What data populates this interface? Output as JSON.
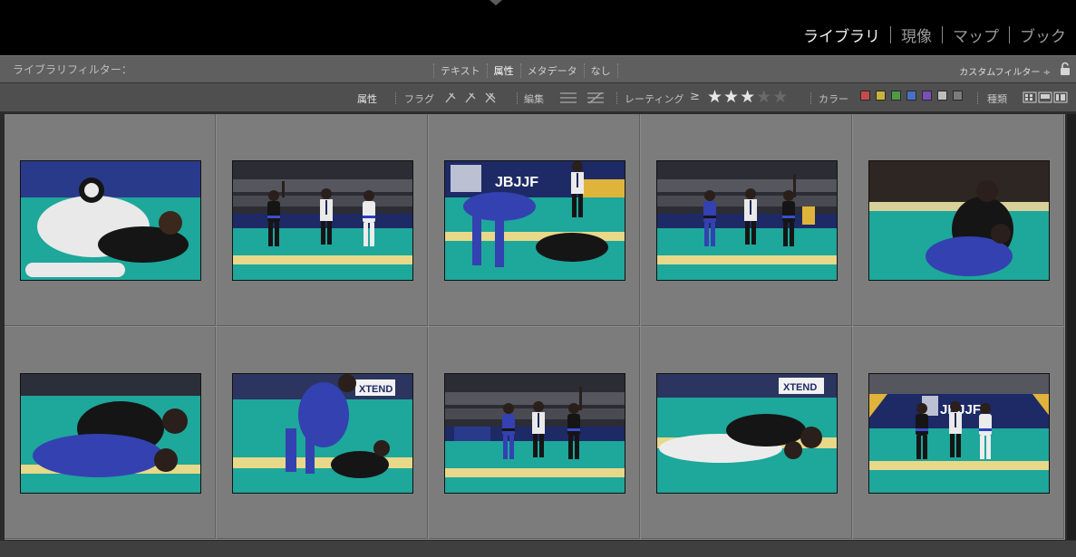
{
  "modules": [
    {
      "label": "ライブラリ",
      "active": true
    },
    {
      "label": "現像",
      "active": false
    },
    {
      "label": "マップ",
      "active": false
    },
    {
      "label": "ブック",
      "active": false
    }
  ],
  "filter_bar": {
    "title": "ライブラリフィルター：",
    "tabs": [
      {
        "label": "テキスト",
        "active": false
      },
      {
        "label": "属性",
        "active": true
      },
      {
        "label": "メタデータ",
        "active": false
      },
      {
        "label": "なし",
        "active": false
      }
    ],
    "custom_filter": "カスタムフィルター ÷"
  },
  "attribute_bar": {
    "title": "属性",
    "flag_label": "フラグ",
    "edit_label": "編集",
    "rating_label": "レーティング",
    "rating_op": "≥",
    "rating_value": 3,
    "rating_max": 5,
    "color_label": "カラー",
    "type_label": "種類",
    "colors": [
      "#c54b4b",
      "#c9b33b",
      "#4f9a49",
      "#4a6fc4",
      "#7a4fb8",
      "#bdbdbd",
      "#7b7b7b"
    ]
  },
  "thumbnails": [
    {
      "scene": "grapple-gi-closeup"
    },
    {
      "scene": "referee-raise"
    },
    {
      "scene": "takedown-banner"
    },
    {
      "scene": "three-stand"
    },
    {
      "scene": "guard-blue-top"
    },
    {
      "scene": "scramble-blue"
    },
    {
      "scene": "standing-pass"
    },
    {
      "scene": "referee-raise-2"
    },
    {
      "scene": "white-gi-pin"
    },
    {
      "scene": "jbjjf-podium"
    }
  ]
}
